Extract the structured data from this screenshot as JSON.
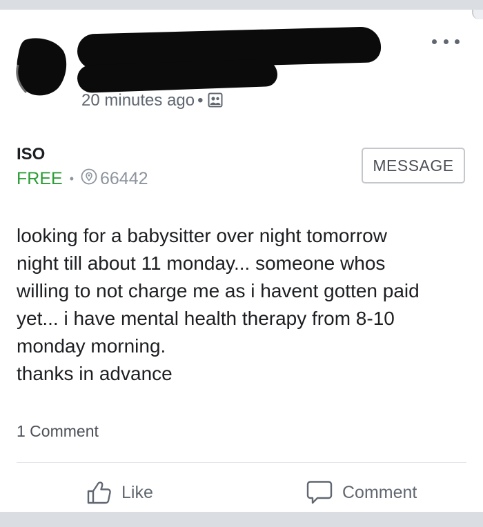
{
  "post": {
    "timestamp": "20 minutes ago",
    "timestamp_separator": "•",
    "privacy_icon": "group-members-icon",
    "more_icon": "more-options-icon"
  },
  "listing": {
    "title": "ISO",
    "price": "FREE",
    "separator": "•",
    "location_icon": "location-pin-icon",
    "location": "66442",
    "message_label": "MESSAGE"
  },
  "body": {
    "lines": [
      "looking for a babysitter over night tomorrow",
      "night till about 11 monday... someone whos",
      "willing to not charge me as i havent gotten paid",
      "yet... i have mental health therapy from 8-10",
      "monday morning.",
      "thanks in advance"
    ]
  },
  "footer": {
    "comment_count": "1 Comment",
    "like_label": "Like",
    "comment_label": "Comment"
  },
  "colors": {
    "price_green": "#2a9d34",
    "text_gray": "#606770",
    "background": "#dadde1"
  }
}
